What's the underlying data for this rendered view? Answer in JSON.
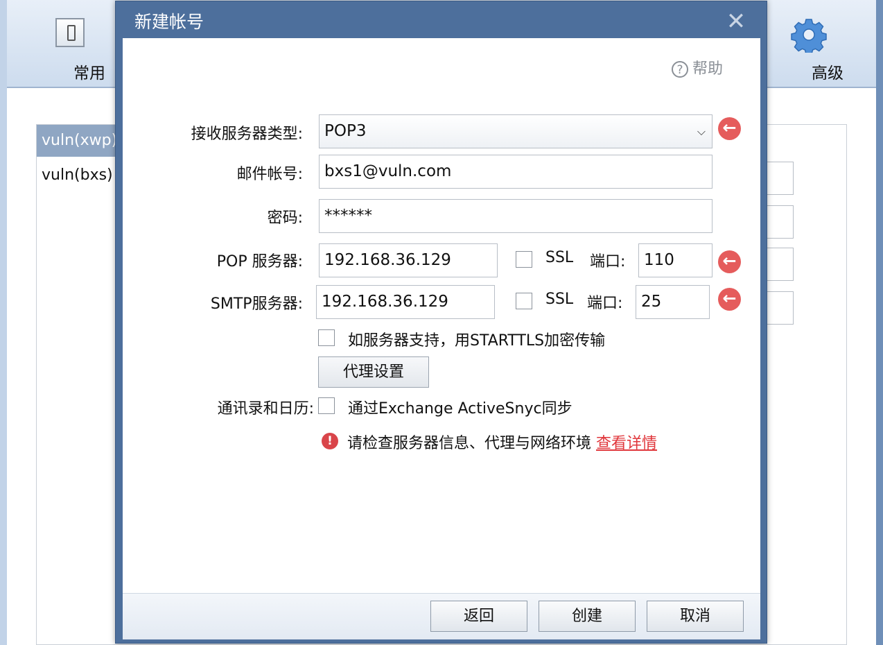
{
  "background": {
    "toolbar": {
      "general_label": "常用",
      "advanced_label": "高级"
    },
    "account_list": [
      "vuln(xwp)",
      "vuln(bxs)"
    ]
  },
  "dialog": {
    "title": "新建帐号",
    "close_glyph": "✕",
    "help_label": "帮助",
    "help_glyph": "?",
    "server_type": {
      "label": "接收服务器类型:",
      "value": "POP3",
      "options": [
        "POP3"
      ]
    },
    "email": {
      "label": "邮件帐号:",
      "value": "bxs1@vuln.com"
    },
    "password": {
      "label": "密码:",
      "value": "******"
    },
    "pop": {
      "label": "POP 服务器:",
      "host": "192.168.36.129",
      "ssl_label": "SSL",
      "port_label": "端口:",
      "port": "110"
    },
    "smtp": {
      "label": "SMTP服务器:",
      "host": "192.168.36.129",
      "ssl_label": "SSL",
      "port_label": "端口:",
      "port": "25"
    },
    "starttls_label": "如服务器支持，用STARTTLS加密传输",
    "proxy_button": "代理设置",
    "contacts_label": "通讯录和日历:",
    "activesync_label": "通过Exchange ActiveSnyc同步",
    "error": {
      "icon_glyph": "!",
      "message": "请检查服务器信息、代理与网络环境 ",
      "link": "查看详情"
    },
    "footer": {
      "back": "返回",
      "create": "创建",
      "cancel": "取消"
    },
    "colors": {
      "title_bar": "#4d6f9c",
      "alert_red": "#e55c5c",
      "link_red": "#e0363b"
    }
  }
}
